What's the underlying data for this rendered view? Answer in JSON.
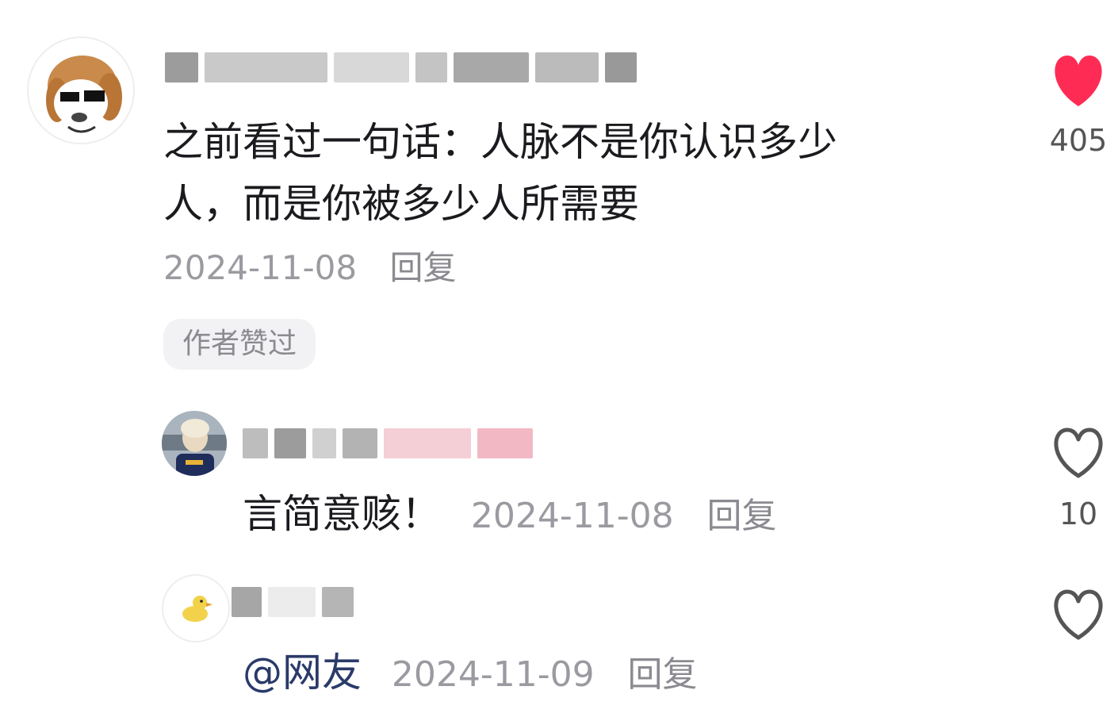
{
  "comment": {
    "text": "之前看过一句话：人脉不是你认识多少人，而是你被多少人所需要",
    "text_line1": "之前看过一句话：人脉不是你认识多少",
    "text_line2": "人，而是你被多少人所需要",
    "date": "2024-11-08",
    "reply_label": "回复",
    "author_liked_badge": "作者赞过",
    "likes": "405",
    "liked": true,
    "avatar_icon": "dog-cartoon-avatar"
  },
  "replies": [
    {
      "text": "言简意赅！",
      "date": "2024-11-08",
      "reply_label": "回复",
      "likes": "10",
      "liked": false,
      "avatar_icon": "person-photo-avatar"
    },
    {
      "mention": "@网友",
      "date": "2024-11-09",
      "reply_label": "回复",
      "likes": "",
      "liked": false,
      "avatar_icon": "duck-avatar"
    }
  ],
  "colors": {
    "heart_liked": "#fe2c55",
    "heart_outline": "#555555",
    "meta_gray": "#9a9aa0",
    "mention_blue": "#2a3b69"
  }
}
